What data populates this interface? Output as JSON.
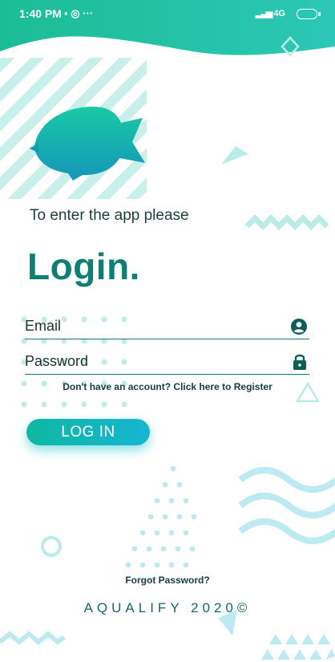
{
  "status_bar": {
    "time": "1:40 PM",
    "notification_icons": "▪ ◎ ···",
    "network": "4G"
  },
  "login": {
    "prompt": "To enter the app please",
    "title": "Login.",
    "email_placeholder": "Email",
    "password_placeholder": "Password",
    "register_link": "Don't have an account? Click here to Register",
    "login_button": "LOG IN",
    "forgot_password": "Forgot Password?"
  },
  "footer": {
    "brand": "AQUALIFY 2020©"
  },
  "colors": {
    "primary": "#0f7f73",
    "accent": "#16b6d2",
    "decor": "#b9ece6"
  },
  "icons": [
    "fish-logo",
    "person-circle-icon",
    "lock-icon",
    "battery-icon",
    "signal-icon"
  ]
}
